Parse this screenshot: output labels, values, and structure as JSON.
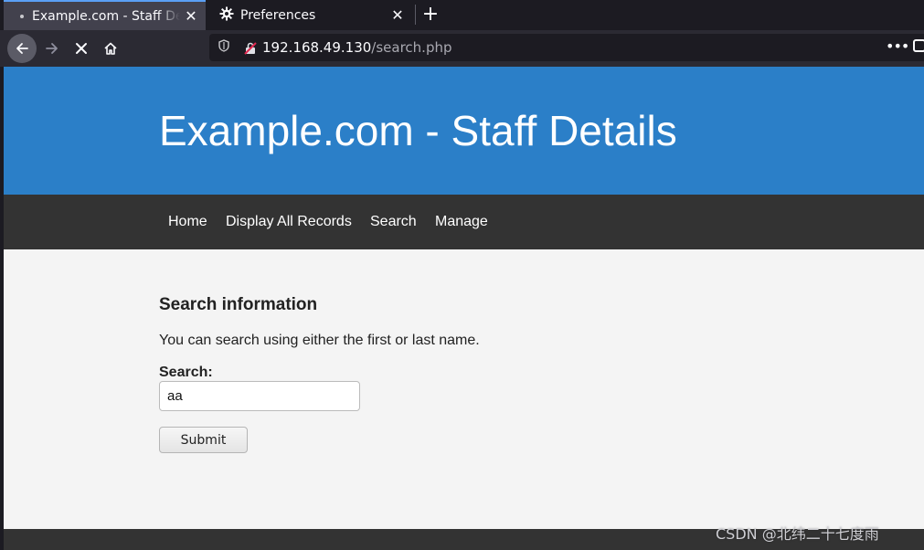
{
  "browser": {
    "tabs": [
      {
        "label": "Example.com - Staff Details",
        "active": true
      },
      {
        "label": "Preferences",
        "active": false
      }
    ],
    "tab_close_glyph": "✕",
    "new_tab_glyph": "+",
    "url_host": "192.168.49.130",
    "url_path": "/search.php",
    "page_actions_glyph": "•••",
    "icons": [
      "back-arrow-icon",
      "forward-arrow-icon",
      "stop-icon",
      "home-icon",
      "tracking-shield-icon",
      "insecure-lock-icon",
      "gear-icon",
      "pocket-icon"
    ]
  },
  "site": {
    "title": "Example.com - Staff Details",
    "nav": [
      "Home",
      "Display All Records",
      "Search",
      "Manage"
    ],
    "header_color": "#2b7fc8",
    "nav_color": "#333333"
  },
  "search": {
    "heading": "Search information",
    "description": "You can search using either the first or last name.",
    "field_label": "Search:",
    "field_value": "aa",
    "submit_label": "Submit"
  },
  "watermark": "CSDN @北纬二十七度雨"
}
